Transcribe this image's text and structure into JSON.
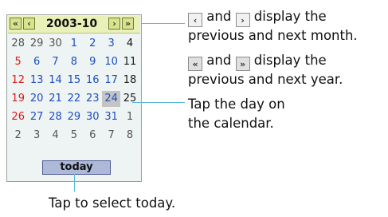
{
  "calendar": {
    "month_label": "2003-10",
    "nav": {
      "prev_year_icon": "double-left-arrow",
      "prev_month_icon": "left-arrow",
      "next_month_icon": "right-arrow",
      "next_year_icon": "double-right-arrow"
    },
    "weeks": [
      [
        "28",
        "29",
        "30",
        "1",
        "2",
        "3",
        "4"
      ],
      [
        "5",
        "6",
        "7",
        "8",
        "9",
        "10",
        "11"
      ],
      [
        "12",
        "13",
        "14",
        "15",
        "16",
        "17",
        "18"
      ],
      [
        "19",
        "20",
        "21",
        "22",
        "23",
        "24",
        "25"
      ],
      [
        "26",
        "27",
        "28",
        "29",
        "30",
        "31",
        "1"
      ],
      [
        "2",
        "3",
        "4",
        "5",
        "6",
        "7",
        "8"
      ]
    ],
    "selected_day": "24",
    "today_label": "today"
  },
  "callouts": {
    "month_nav_and": "and",
    "month_nav_line1_rest": "display the",
    "month_nav_line2": "previous and next month.",
    "year_nav_and": "and",
    "year_nav_line1_rest": "display the",
    "year_nav_line2": "previous and next year.",
    "tap_day_line1": "Tap the day on",
    "tap_day_line2": "the calendar.",
    "tap_today": "Tap to select today."
  },
  "colors": {
    "leader_line": "#58b8d6",
    "header_bg": "#e9f0b8",
    "today_bg": "#aeb8d8",
    "sunday": "#e01818",
    "current_month": "#1d4fbf"
  }
}
